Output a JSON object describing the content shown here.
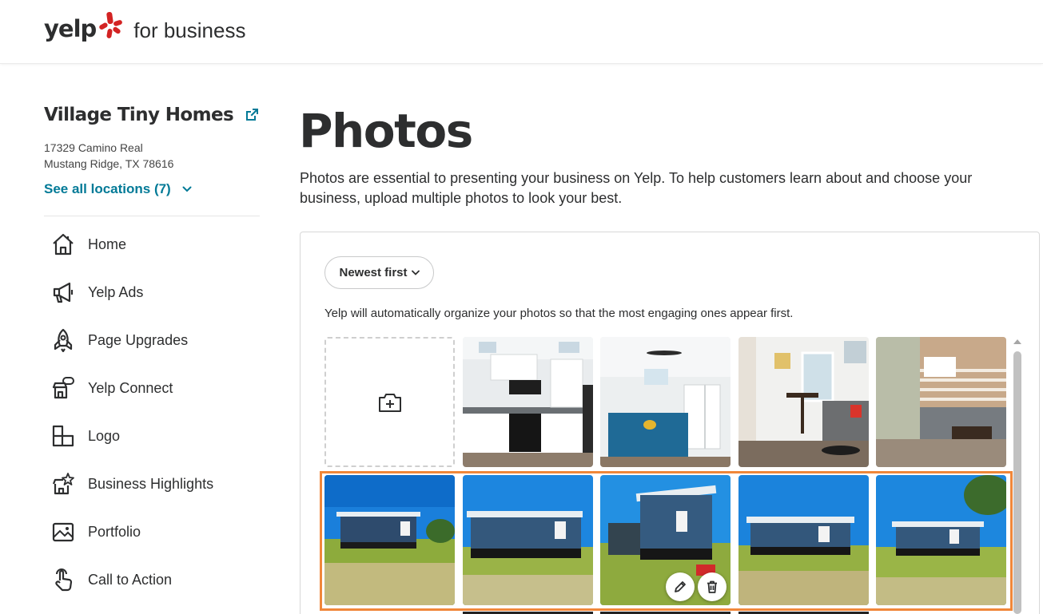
{
  "header": {
    "logo_text": "yelp",
    "logo_sub": "for business",
    "brand_color": "#d32323"
  },
  "sidebar": {
    "business_name": "Village Tiny Homes",
    "address_line1": "17329 Camino Real",
    "address_line2": "Mustang Ridge, TX 78616",
    "see_all_label": "See all locations (7)",
    "link_color": "#027a97",
    "items": [
      {
        "label": "Home",
        "icon": "home-icon"
      },
      {
        "label": "Yelp Ads",
        "icon": "megaphone-icon"
      },
      {
        "label": "Page Upgrades",
        "icon": "rocket-icon"
      },
      {
        "label": "Yelp Connect",
        "icon": "storefront-chat-icon"
      },
      {
        "label": "Logo",
        "icon": "logo-blocks-icon"
      },
      {
        "label": "Business Highlights",
        "icon": "store-star-icon"
      },
      {
        "label": "Portfolio",
        "icon": "portfolio-images-icon"
      },
      {
        "label": "Call to Action",
        "icon": "pointer-hand-icon"
      }
    ]
  },
  "main": {
    "title": "Photos",
    "intro": "Photos are essential to presenting your business on Yelp. To help customers learn about and choose your business, upload multiple photos to look your best.",
    "sort_label": "Newest first",
    "helper_text": "Yelp will automatically organize your photos so that the most engaging ones appear first.",
    "photo_grid": {
      "upload_icon": "add-photo-icon",
      "photos": [
        {
          "subject": "kitchen",
          "icon": "photo-thumbnail"
        },
        {
          "subject": "bedroom",
          "icon": "photo-thumbnail"
        },
        {
          "subject": "dining-nook",
          "icon": "photo-thumbnail"
        },
        {
          "subject": "porch-lounge",
          "icon": "photo-thumbnail"
        },
        {
          "subject": "tiny-home-exterior",
          "icon": "photo-thumbnail"
        },
        {
          "subject": "tiny-home-exterior",
          "icon": "photo-thumbnail"
        },
        {
          "subject": "tiny-home-exterior-for-sale",
          "icon": "photo-thumbnail"
        },
        {
          "subject": "tiny-home-exterior",
          "icon": "photo-thumbnail"
        },
        {
          "subject": "tiny-home-exterior",
          "icon": "photo-thumbnail"
        }
      ],
      "highlight_color": "#f0873a"
    }
  }
}
